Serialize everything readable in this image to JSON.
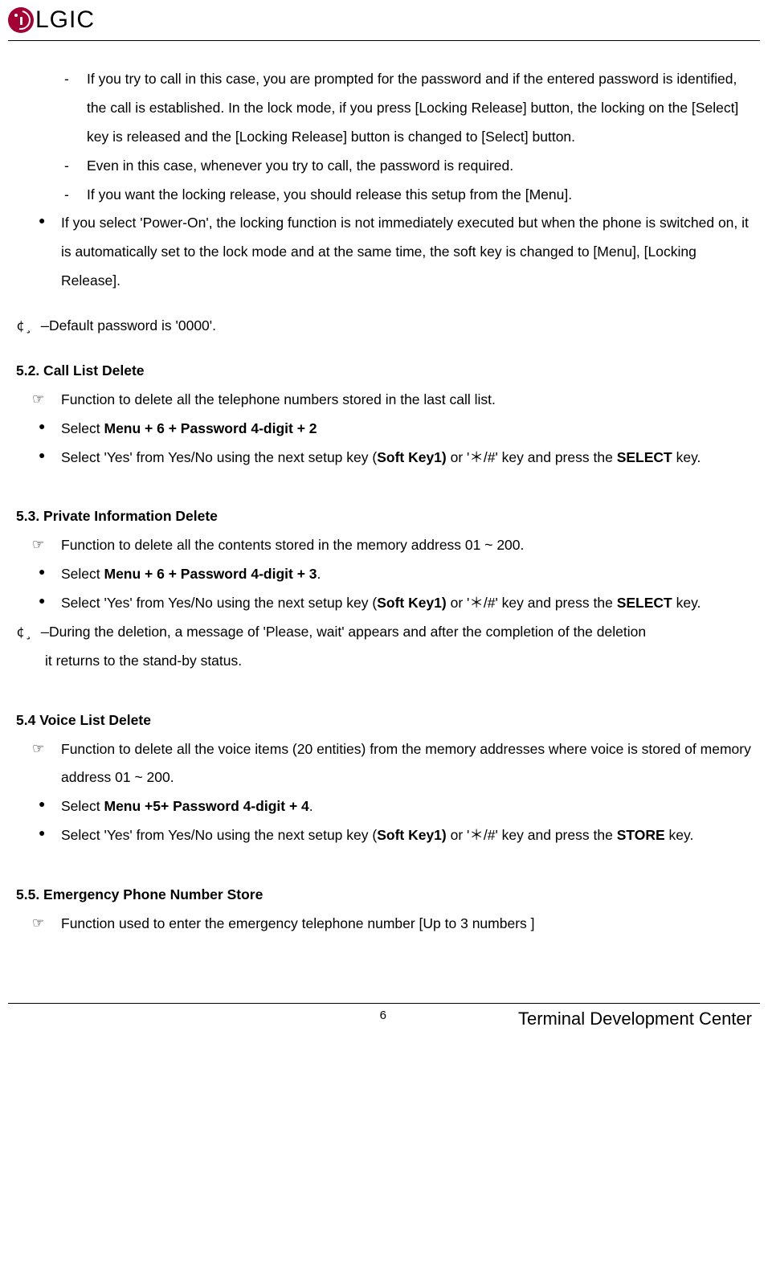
{
  "header": {
    "logo_text": "LGIC"
  },
  "body": {
    "dash1": "If you try to call in this case, you are prompted for the password and if the entered password is identified, the call is established. In the lock mode, if you press [Locking Release] button, the locking on the [Select] key is released and the [Locking Release] button is changed to [Select] button.",
    "dash2": "Even in this case, whenever you try to call, the password is required.",
    "dash3": "If you want the locking release, you should release this setup from the [Menu].",
    "dot1": "If you select 'Power-On', the locking function is not immediately executed but when the phone is switched on, it is automatically set to the lock mode and at the same time, the soft key is changed to [Menu], [Locking Release].",
    "note1_prefix": "¢¸ ―",
    "note1": "Default password is '0000'.",
    "sec52_title": "5.2. Call List Delete",
    "sec52_pointer": " Function to delete all the telephone numbers stored in the last call list.",
    "sec52_dot1_a": "Select ",
    "sec52_dot1_b": "Menu + 6 + Password 4-digit + 2",
    "sec52_dot2_a": "Select 'Yes' from Yes/No using the next setup key (",
    "sec52_dot2_b": "Soft Key1)",
    "sec52_dot2_c": " or '＊/#' key and press the ",
    "sec52_dot2_d": "SELECT",
    "sec52_dot2_e": " key.",
    "sec53_title": "5.3. Private Information Delete",
    "sec53_pointer": " Function to delete all the contents stored in the memory address 01 ~ 200.",
    "sec53_dot1_a": "Select ",
    "sec53_dot1_b": "Menu + 6 + Password 4-digit + 3",
    "sec53_dot1_c": ".",
    "sec53_dot2_a": "Select 'Yes' from Yes/No using the next setup key (",
    "sec53_dot2_b": "Soft Key1)",
    "sec53_dot2_c": " or '＊/#' key and press the ",
    "sec53_dot2_d": "SELECT",
    "sec53_dot2_e": " key.",
    "sec53_note_prefix": "¢¸ ―",
    "sec53_note": "During the deletion, a message of 'Please, wait' appears and after the completion of the deletion it returns to the stand-by status.",
    "sec54_title": "5.4 Voice List Delete",
    "sec54_pointer": "Function to delete all the voice items (20 entities) from the memory addresses where voice is stored of memory address 01 ~ 200.",
    "sec54_dot1_a": "Select ",
    "sec54_dot1_b": "Menu +5+ Password 4-digit + 4",
    "sec54_dot1_c": ".",
    "sec54_dot2_a": "Select 'Yes' from Yes/No using the next setup key (",
    "sec54_dot2_b": "Soft Key1)",
    "sec54_dot2_c": " or '＊/#' key and press the ",
    "sec54_dot2_d": "STORE",
    "sec54_dot2_e": " key.",
    "sec55_title": "5.5. Emergency Phone Number Store",
    "sec55_pointer": "Function used to enter the emergency telephone number [Up to 3 numbers ]"
  },
  "footer": {
    "page": "6",
    "center": "Terminal Development Center"
  }
}
